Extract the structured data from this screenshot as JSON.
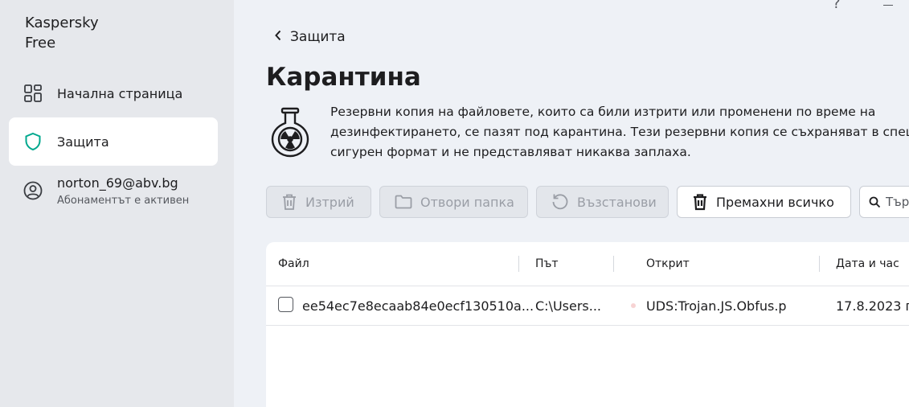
{
  "app": {
    "brand_line1": "Kaspersky",
    "brand_line2": "Free"
  },
  "sidebar": {
    "items": [
      {
        "label": "Начална страница",
        "icon": "home-grid-icon"
      },
      {
        "label": "Защита",
        "icon": "shield-icon",
        "active": true
      }
    ],
    "account": {
      "email": "norton_69@abv.bg",
      "status": "Абонаментът е активен",
      "icon": "user-circle-icon"
    }
  },
  "window": {
    "help": "?"
  },
  "header": {
    "back_label": "Защита",
    "title": "Карантина"
  },
  "description": {
    "line1": "Резервни копия на файловете, които са били изтрити или променени по време на",
    "line2": "дезинфектирането, се пазят под карантина. Тези резервни копия се съхраняват в специал",
    "line3": "сигурен формат и не представляват никаква заплаха.",
    "icon": "radiation-flask-icon"
  },
  "toolbar": {
    "delete_label": "Изтрий",
    "open_folder_label": "Отвори папка",
    "restore_label": "Възстанови",
    "remove_all_label": "Премахни всичко",
    "search_placeholder": "Търс"
  },
  "table": {
    "columns": [
      "Файл",
      "Път",
      "Открит",
      "Дата и час"
    ],
    "rows": [
      {
        "file": "ee54ec7e8ecaab84e0ecf130510a...",
        "path": "C:\\Users...",
        "detected": "UDS:Trojan.JS.Obfus.p",
        "datetime": "17.8.2023 г."
      }
    ]
  },
  "colors": {
    "accent": "#00a88e",
    "sidebar_bg": "#e6e8ec",
    "main_bg": "#eef1f6",
    "disabled_text": "#9a9ea6"
  }
}
